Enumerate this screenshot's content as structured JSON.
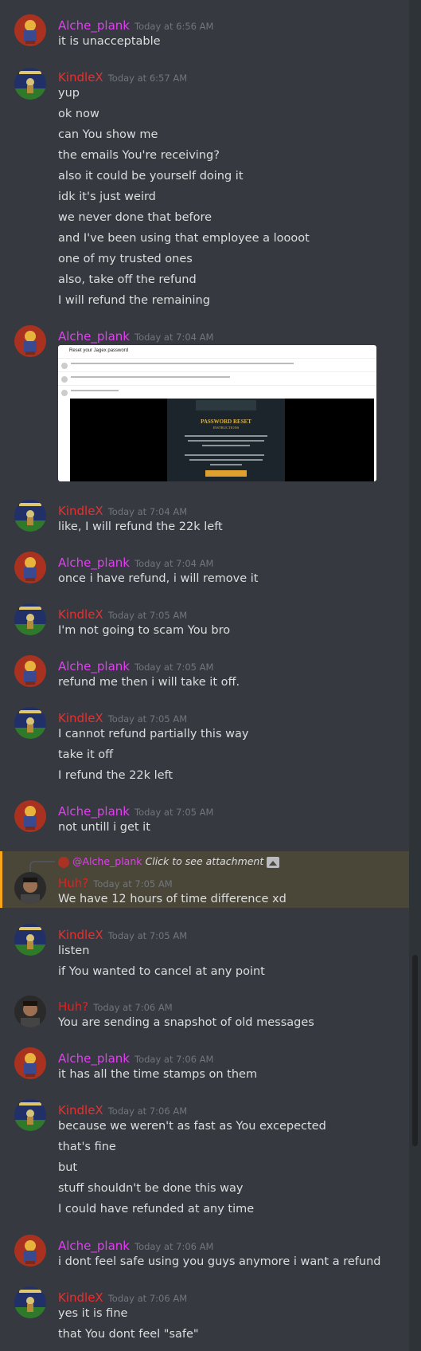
{
  "colors": {
    "alche": "#e23ef2",
    "kindle": "#ed2e2e",
    "huh": "#ee1c1c",
    "background": "#36393f",
    "timestamp": "#72767d",
    "mention_highlight": "#4a4638"
  },
  "messages": [
    {
      "user": "Alche_plank",
      "avatar": "alche",
      "time": "Today at 6:56 AM",
      "lines": [
        "it is unacceptable"
      ]
    },
    {
      "user": "KindleX",
      "avatar": "kindle",
      "time": "Today at 6:57 AM",
      "lines": [
        "yup",
        "ok now",
        "can You show me",
        "the emails You're receiving?",
        "also it could be yourself doing it",
        "idk it's just weird",
        "we never done that before",
        "and I've been using that employee a loooot",
        "one of my trusted ones",
        "also, take off the refund",
        "I will refund the remaining"
      ]
    },
    {
      "user": "Alche_plank",
      "avatar": "alche",
      "time": "Today at 7:04 AM",
      "lines": []
    },
    {
      "user": "KindleX",
      "avatar": "kindle",
      "time": "Today at 7:04 AM",
      "lines": [
        "like, I will refund the 22k left"
      ]
    },
    {
      "user": "Alche_plank",
      "avatar": "alche",
      "time": "Today at 7:04 AM",
      "lines": [
        "once i have refund, i will remove it"
      ]
    },
    {
      "user": "KindleX",
      "avatar": "kindle",
      "time": "Today at 7:05 AM",
      "lines": [
        "I'm not going to scam You bro"
      ]
    },
    {
      "user": "Alche_plank",
      "avatar": "alche",
      "time": "Today at 7:05 AM",
      "lines": [
        "refund me then i will take it off."
      ]
    },
    {
      "user": "KindleX",
      "avatar": "kindle",
      "time": "Today at 7:05 AM",
      "lines": [
        "I cannot refund partially this way",
        "take it off",
        "I refund the 22k left"
      ]
    },
    {
      "user": "Alche_plank",
      "avatar": "alche",
      "time": "Today at 7:05 AM",
      "lines": [
        "not untill i get it"
      ]
    },
    {
      "user": "Huh?",
      "avatar": "huh",
      "time": "Today at 7:05 AM",
      "lines": [
        "We have 12 hours of time difference xd"
      ]
    },
    {
      "user": "KindleX",
      "avatar": "kindle",
      "time": "Today at 7:05 AM",
      "lines": [
        "listen",
        "if You wanted to cancel at any point"
      ]
    },
    {
      "user": "Huh?",
      "avatar": "huh",
      "time": "Today at 7:06 AM",
      "lines": [
        "You are sending a snapshot of old messages"
      ]
    },
    {
      "user": "Alche_plank",
      "avatar": "alche",
      "time": "Today at 7:06 AM",
      "lines": [
        "it has all the time stamps on them"
      ]
    },
    {
      "user": "KindleX",
      "avatar": "kindle",
      "time": "Today at 7:06 AM",
      "lines": [
        "because we weren't as fast as You excepected",
        "that's fine",
        "but",
        "stuff shouldn't be done this way",
        "I could have refunded at any time"
      ]
    },
    {
      "user": "Alche_plank",
      "avatar": "alche",
      "time": "Today at 7:06 AM",
      "lines": [
        "i dont feel safe using you guys anymore i want a refund"
      ]
    },
    {
      "user": "KindleX",
      "avatar": "kindle",
      "time": "Today at 7:06 AM",
      "lines": [
        "yes it is fine",
        "that You dont feel \"safe\""
      ]
    }
  ],
  "reply": {
    "mention": "@Alche_plank",
    "text": "Click to see attachment",
    "icon": "image-icon"
  },
  "attachment": {
    "email_title": "Reset your Jagex password",
    "heading": "PASSWORD RESET",
    "subheading": "INSTRUCTIONS",
    "button": "RESET PASSWORD"
  }
}
